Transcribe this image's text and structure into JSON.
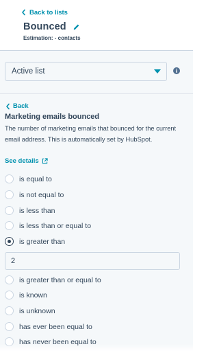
{
  "header": {
    "back_label": "Back to lists",
    "list_name": "Bounced",
    "estimation": "Estimation: - contacts"
  },
  "panel": {
    "list_type": "Active list",
    "back_label": "Back",
    "property": {
      "name": "Marketing emails bounced",
      "description": "The number of marketing emails that bounced for the current email address. This is automatically set by HubSpot.",
      "see_details": "See details"
    },
    "operators": [
      {
        "label": "is equal to",
        "checked": false
      },
      {
        "label": "is not equal to",
        "checked": false
      },
      {
        "label": "is less than",
        "checked": false
      },
      {
        "label": "is less than or equal to",
        "checked": false
      },
      {
        "label": "is greater than",
        "checked": true
      },
      {
        "label": "is greater than or equal to",
        "checked": false
      },
      {
        "label": "is known",
        "checked": false
      },
      {
        "label": "is unknown",
        "checked": false
      },
      {
        "label": "has ever been equal to",
        "checked": false
      },
      {
        "label": "has never been equal to",
        "checked": false
      }
    ],
    "value": "2"
  },
  "colors": {
    "link": "#0091ae",
    "text": "#33475b",
    "panel_bg": "#f5f8fa",
    "border": "#cbd6e2"
  }
}
